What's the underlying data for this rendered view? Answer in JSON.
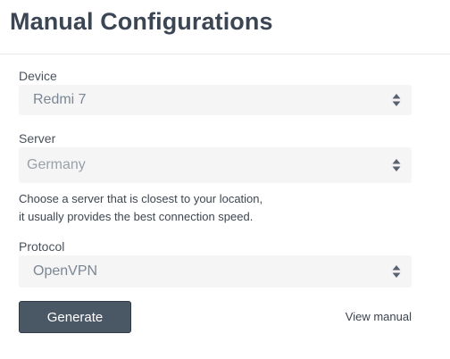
{
  "page": {
    "title": "Manual Configurations"
  },
  "form": {
    "device": {
      "label": "Device",
      "value": "Redmi 7"
    },
    "server": {
      "label": "Server",
      "value": "Germany",
      "help_line1": "Choose a server that is closest to your location,",
      "help_line2": "it usually provides the best connection speed."
    },
    "protocol": {
      "label": "Protocol",
      "value": "OpenVPN"
    }
  },
  "actions": {
    "generate_label": "Generate",
    "view_manual_label": "View manual"
  },
  "colors": {
    "button_bg": "#4a5866",
    "select_bg": "#f5f5f6",
    "title_color": "#3b4554"
  },
  "icons": {
    "select_arrows": "sort-arrows-icon"
  }
}
